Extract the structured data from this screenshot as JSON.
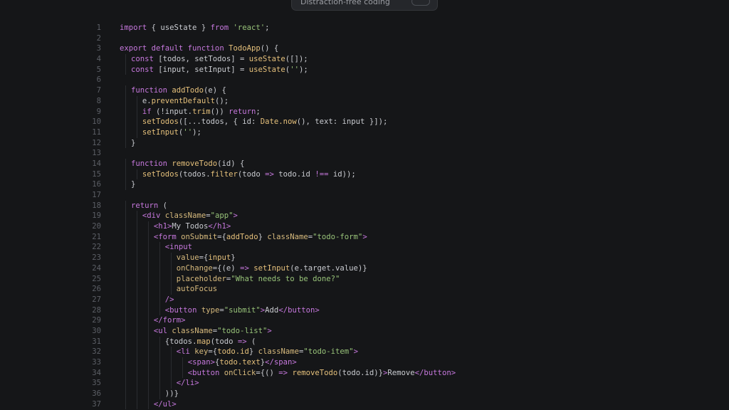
{
  "toast": {
    "label": "Distraction-free coding"
  },
  "editor": {
    "lines": [
      {
        "n": "1",
        "indent": 0,
        "tokens": [
          [
            "kw",
            "import"
          ],
          [
            "pl",
            " { useState } "
          ],
          [
            "kw",
            "from"
          ],
          [
            "pl",
            " "
          ],
          [
            "str",
            "'react'"
          ],
          [
            "pl",
            ";"
          ]
        ]
      },
      {
        "n": "2",
        "indent": 0,
        "tokens": []
      },
      {
        "n": "3",
        "indent": 0,
        "tokens": [
          [
            "kw",
            "export default function"
          ],
          [
            "pl",
            " "
          ],
          [
            "fn",
            "TodoApp"
          ],
          [
            "pl",
            "() {"
          ]
        ]
      },
      {
        "n": "4",
        "indent": 1,
        "tokens": [
          [
            "kw",
            "const"
          ],
          [
            "pl",
            " [todos, setTodos] = "
          ],
          [
            "fn",
            "useState"
          ],
          [
            "pl",
            "([]);"
          ]
        ]
      },
      {
        "n": "5",
        "indent": 1,
        "tokens": [
          [
            "kw",
            "const"
          ],
          [
            "pl",
            " [input, setInput] = "
          ],
          [
            "fn",
            "useState"
          ],
          [
            "pl",
            "("
          ],
          [
            "str",
            "''"
          ],
          [
            "pl",
            ");"
          ]
        ]
      },
      {
        "n": "6",
        "indent": 0,
        "tokens": []
      },
      {
        "n": "7",
        "indent": 1,
        "tokens": [
          [
            "kw",
            "function"
          ],
          [
            "pl",
            " "
          ],
          [
            "fn",
            "addTodo"
          ],
          [
            "pl",
            "(e) {"
          ]
        ]
      },
      {
        "n": "8",
        "indent": 2,
        "tokens": [
          [
            "pl",
            "e."
          ],
          [
            "fn",
            "preventDefault"
          ],
          [
            "pl",
            "();"
          ]
        ]
      },
      {
        "n": "9",
        "indent": 2,
        "tokens": [
          [
            "kw",
            "if"
          ],
          [
            "pl",
            " (!input."
          ],
          [
            "fn",
            "trim"
          ],
          [
            "pl",
            "()) "
          ],
          [
            "kw",
            "return"
          ],
          [
            "pl",
            ";"
          ]
        ]
      },
      {
        "n": "10",
        "indent": 2,
        "tokens": [
          [
            "fn",
            "setTodos"
          ],
          [
            "pl",
            "([...todos, { id: "
          ],
          [
            "fn",
            "Date.now"
          ],
          [
            "pl",
            "(), text: input }]);"
          ]
        ]
      },
      {
        "n": "11",
        "indent": 2,
        "tokens": [
          [
            "fn",
            "setInput"
          ],
          [
            "pl",
            "("
          ],
          [
            "str",
            "''"
          ],
          [
            "pl",
            ");"
          ]
        ]
      },
      {
        "n": "12",
        "indent": 1,
        "tokens": [
          [
            "pl",
            "}"
          ]
        ]
      },
      {
        "n": "13",
        "indent": 0,
        "tokens": []
      },
      {
        "n": "14",
        "indent": 1,
        "tokens": [
          [
            "kw",
            "function"
          ],
          [
            "pl",
            " "
          ],
          [
            "fn",
            "removeTodo"
          ],
          [
            "pl",
            "(id) {"
          ]
        ]
      },
      {
        "n": "15",
        "indent": 2,
        "tokens": [
          [
            "fn",
            "setTodos"
          ],
          [
            "pl",
            "(todos."
          ],
          [
            "fn",
            "filter"
          ],
          [
            "pl",
            "(todo "
          ],
          [
            "kw",
            "=>"
          ],
          [
            "pl",
            " todo.id "
          ],
          [
            "kw",
            "!=="
          ],
          [
            "pl",
            " id));"
          ]
        ]
      },
      {
        "n": "16",
        "indent": 1,
        "tokens": [
          [
            "pl",
            "}"
          ]
        ]
      },
      {
        "n": "17",
        "indent": 0,
        "tokens": []
      },
      {
        "n": "18",
        "indent": 1,
        "tokens": [
          [
            "kw",
            "return"
          ],
          [
            "pl",
            " ("
          ]
        ]
      },
      {
        "n": "19",
        "indent": 2,
        "tokens": [
          [
            "tag",
            "<div"
          ],
          [
            "pl",
            " "
          ],
          [
            "attr",
            "className"
          ],
          [
            "pl",
            "="
          ],
          [
            "str",
            "\"app\""
          ],
          [
            "tag",
            ">"
          ]
        ]
      },
      {
        "n": "20",
        "indent": 3,
        "tokens": [
          [
            "tag",
            "<h1>"
          ],
          [
            "pl",
            "My Todos"
          ],
          [
            "tag",
            "</h1>"
          ]
        ]
      },
      {
        "n": "21",
        "indent": 3,
        "tokens": [
          [
            "tag",
            "<form"
          ],
          [
            "pl",
            " "
          ],
          [
            "attr",
            "onSubmit"
          ],
          [
            "pl",
            "={"
          ],
          [
            "fn",
            "addTodo"
          ],
          [
            "pl",
            "} "
          ],
          [
            "attr",
            "className"
          ],
          [
            "pl",
            "="
          ],
          [
            "str",
            "\"todo-form\""
          ],
          [
            "tag",
            ">"
          ]
        ]
      },
      {
        "n": "22",
        "indent": 4,
        "tokens": [
          [
            "tag",
            "<input"
          ]
        ]
      },
      {
        "n": "23",
        "indent": 5,
        "tokens": [
          [
            "attr",
            "value"
          ],
          [
            "pl",
            "={"
          ],
          [
            "fn",
            "input"
          ],
          [
            "pl",
            "}"
          ]
        ]
      },
      {
        "n": "24",
        "indent": 5,
        "tokens": [
          [
            "attr",
            "onChange"
          ],
          [
            "pl",
            "={(e) "
          ],
          [
            "kw",
            "=>"
          ],
          [
            "pl",
            " "
          ],
          [
            "fn",
            "setInput"
          ],
          [
            "pl",
            "(e.target.value)}"
          ]
        ]
      },
      {
        "n": "25",
        "indent": 5,
        "tokens": [
          [
            "attr",
            "placeholder"
          ],
          [
            "pl",
            "="
          ],
          [
            "str",
            "\"What needs to be done?\""
          ]
        ]
      },
      {
        "n": "26",
        "indent": 5,
        "tokens": [
          [
            "attr",
            "autoFocus"
          ]
        ]
      },
      {
        "n": "27",
        "indent": 4,
        "tokens": [
          [
            "tag",
            "/>"
          ]
        ]
      },
      {
        "n": "28",
        "indent": 4,
        "tokens": [
          [
            "tag",
            "<button"
          ],
          [
            "pl",
            " "
          ],
          [
            "attr",
            "type"
          ],
          [
            "pl",
            "="
          ],
          [
            "str",
            "\"submit\""
          ],
          [
            "tag",
            ">"
          ],
          [
            "pl",
            "Add"
          ],
          [
            "tag",
            "</button>"
          ]
        ]
      },
      {
        "n": "29",
        "indent": 3,
        "tokens": [
          [
            "tag",
            "</form>"
          ]
        ]
      },
      {
        "n": "30",
        "indent": 3,
        "tokens": [
          [
            "tag",
            "<ul"
          ],
          [
            "pl",
            " "
          ],
          [
            "attr",
            "className"
          ],
          [
            "pl",
            "="
          ],
          [
            "str",
            "\"todo-list\""
          ],
          [
            "tag",
            ">"
          ]
        ]
      },
      {
        "n": "31",
        "indent": 4,
        "tokens": [
          [
            "pl",
            "{todos."
          ],
          [
            "fn",
            "map"
          ],
          [
            "pl",
            "(todo "
          ],
          [
            "kw",
            "=>"
          ],
          [
            "pl",
            " ("
          ]
        ]
      },
      {
        "n": "32",
        "indent": 5,
        "tokens": [
          [
            "tag",
            "<li"
          ],
          [
            "pl",
            " "
          ],
          [
            "attr",
            "key"
          ],
          [
            "pl",
            "={"
          ],
          [
            "fn",
            "todo.id"
          ],
          [
            "pl",
            "} "
          ],
          [
            "attr",
            "className"
          ],
          [
            "pl",
            "="
          ],
          [
            "str",
            "\"todo-item\""
          ],
          [
            "tag",
            ">"
          ]
        ]
      },
      {
        "n": "33",
        "indent": 6,
        "tokens": [
          [
            "tag",
            "<span>"
          ],
          [
            "pl",
            "{"
          ],
          [
            "fn",
            "todo.text"
          ],
          [
            "pl",
            "}"
          ],
          [
            "tag",
            "</span>"
          ]
        ]
      },
      {
        "n": "34",
        "indent": 6,
        "tokens": [
          [
            "tag",
            "<button"
          ],
          [
            "pl",
            " "
          ],
          [
            "attr",
            "onClick"
          ],
          [
            "pl",
            "={() "
          ],
          [
            "kw",
            "=>"
          ],
          [
            "pl",
            " "
          ],
          [
            "fn",
            "removeTodo"
          ],
          [
            "pl",
            "(todo.id)}"
          ],
          [
            "tag",
            ">"
          ],
          [
            "pl",
            "Remove"
          ],
          [
            "tag",
            "</button>"
          ]
        ]
      },
      {
        "n": "35",
        "indent": 5,
        "tokens": [
          [
            "tag",
            "</li>"
          ]
        ]
      },
      {
        "n": "36",
        "indent": 4,
        "tokens": [
          [
            "pl",
            ")"
          ],
          [
            "pl",
            ")}"
          ]
        ]
      },
      {
        "n": "37",
        "indent": 3,
        "tokens": [
          [
            "tag",
            "</ul>"
          ]
        ]
      }
    ]
  }
}
